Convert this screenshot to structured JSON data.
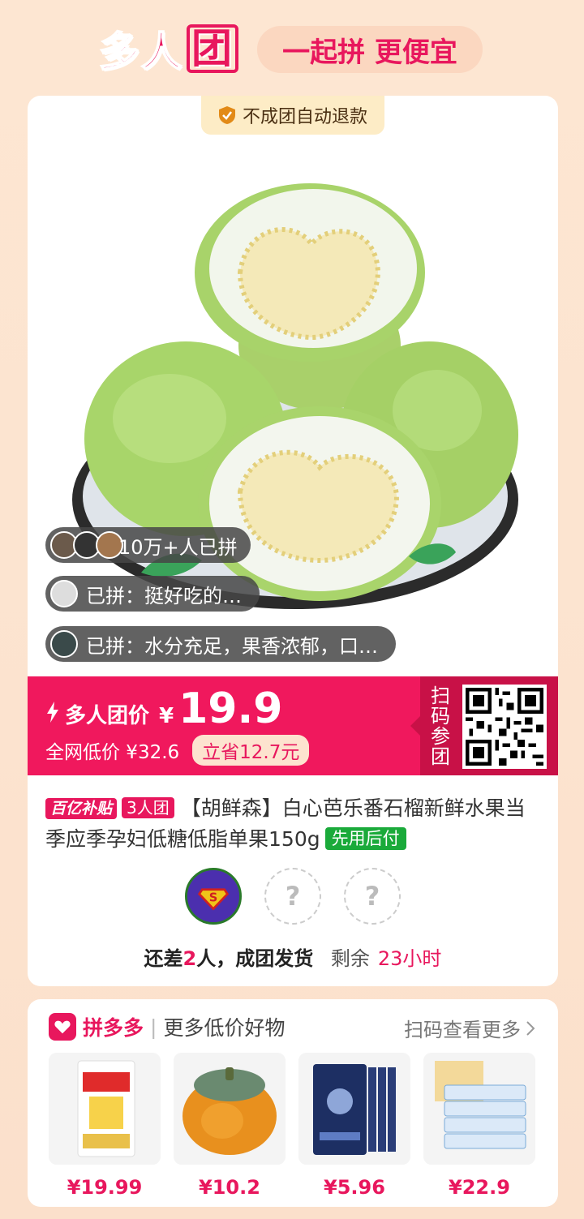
{
  "header": {
    "logo_text": "多人",
    "logo_box_char": "团",
    "slogan": "一起拼 更便宜"
  },
  "product": {
    "guarantee": "不成团自动退款",
    "buyers_count": "10万+人已拼",
    "reviews": [
      "已拼：挺好吃的…",
      "已拼：水分充足，果香浓郁，口…"
    ],
    "group_price_label": "多人团价",
    "currency": "¥",
    "group_price": "19.9",
    "lowest_price": "全网低价 ¥32.6",
    "save": "立省12.7元",
    "scan_label": "扫码参团",
    "tag_subsidy": "百亿补贴",
    "tag_group": "3人团",
    "title": "【胡鲜森】白心芭乐番石榴新鲜水果当季应季孕妇低糖低脂单果150g",
    "tag_pay_later": "先用后付"
  },
  "group_status": {
    "prefix": "还差",
    "missing": "2",
    "suffix": "人，成团发货",
    "remain_label": "剩余",
    "remain_time": "23小时",
    "empty_slot": "?"
  },
  "more": {
    "brand": "拼多多",
    "subtitle": "更多低价好物",
    "scan_more": "扫码查看更多",
    "items": [
      {
        "price": "¥19.99",
        "thumb": "flour-bag"
      },
      {
        "price": "¥10.2",
        "thumb": "pumpkin"
      },
      {
        "price": "¥5.96",
        "thumb": "babycare-wipes"
      },
      {
        "price": "¥22.9",
        "thumb": "tissue-pack"
      }
    ]
  },
  "colors": {
    "brand": "#e8175d",
    "price_band": "#f0185d",
    "green_tag": "#1aaa3a"
  }
}
